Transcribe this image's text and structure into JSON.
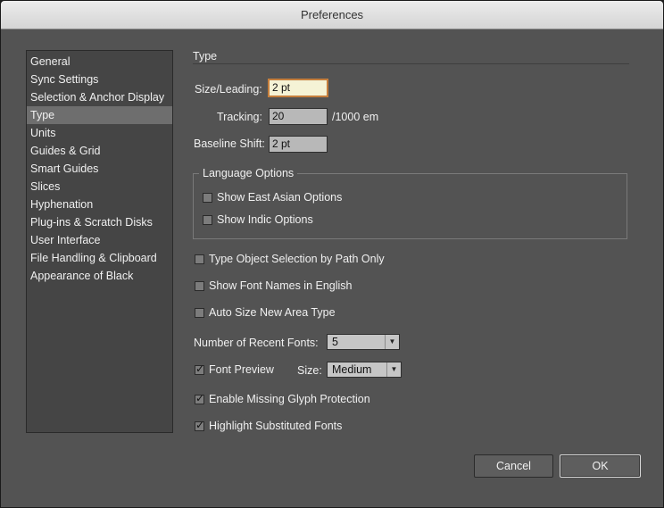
{
  "window": {
    "title": "Preferences"
  },
  "sidebar": {
    "items": [
      {
        "label": "General",
        "selected": false
      },
      {
        "label": "Sync Settings",
        "selected": false
      },
      {
        "label": "Selection & Anchor Display",
        "selected": false
      },
      {
        "label": "Type",
        "selected": true
      },
      {
        "label": "Units",
        "selected": false
      },
      {
        "label": "Guides & Grid",
        "selected": false
      },
      {
        "label": "Smart Guides",
        "selected": false
      },
      {
        "label": "Slices",
        "selected": false
      },
      {
        "label": "Hyphenation",
        "selected": false
      },
      {
        "label": "Plug-ins & Scratch Disks",
        "selected": false
      },
      {
        "label": "User Interface",
        "selected": false
      },
      {
        "label": "File Handling & Clipboard",
        "selected": false
      },
      {
        "label": "Appearance of Black",
        "selected": false
      }
    ]
  },
  "type": {
    "section_title": "Type",
    "size_leading": {
      "label": "Size/Leading:",
      "value": "2 pt"
    },
    "tracking": {
      "label": "Tracking:",
      "value": "20",
      "unit": "/1000 em"
    },
    "baseline_shift": {
      "label": "Baseline Shift:",
      "value": "2 pt"
    },
    "language_options": {
      "title": "Language Options",
      "east_asian": {
        "label": "Show East Asian Options",
        "checked": false
      },
      "indic": {
        "label": "Show Indic Options",
        "checked": false
      }
    },
    "path_only": {
      "label": "Type Object Selection by Path Only",
      "checked": false
    },
    "english_names": {
      "label": "Show Font Names in English",
      "checked": false
    },
    "auto_size": {
      "label": "Auto Size New Area Type",
      "checked": false
    },
    "recent_fonts": {
      "label": "Number of Recent Fonts:",
      "value": "5"
    },
    "font_preview": {
      "label": "Font Preview",
      "checked": true,
      "size_label": "Size:",
      "size_value": "Medium"
    },
    "missing_glyph": {
      "label": "Enable Missing Glyph Protection",
      "checked": true
    },
    "highlight_substituted": {
      "label": "Highlight Substituted Fonts",
      "checked": true
    }
  },
  "buttons": {
    "cancel": "Cancel",
    "ok": "OK"
  }
}
